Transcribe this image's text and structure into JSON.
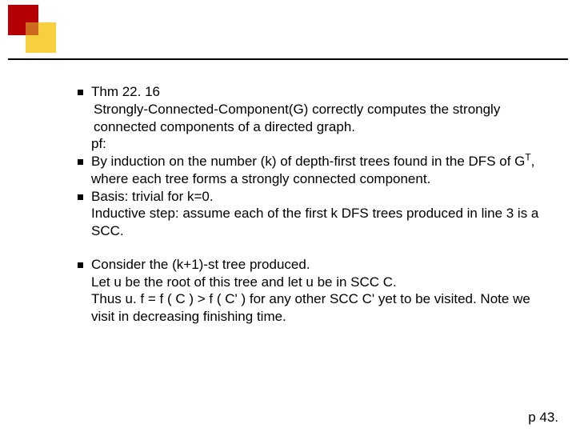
{
  "slide": {
    "b1": "Thm 22. 16",
    "b1_sub1": "Strongly-Connected-Component(G) correctly computes the strongly connected components of a directed graph.",
    "b1_sub2": "pf:",
    "b2_pre": "By induction on the number (k) of depth-first trees found in the DFS of G",
    "b2_sup": "T",
    "b2_post": ", where each tree forms a strongly connected component.",
    "b3": "Basis: trivial for k=0.",
    "b3_sub": "Inductive step: assume each of the first k DFS trees produced in line 3 is a SCC.",
    "b4": "Consider the (k+1)-st tree produced.",
    "b4_sub1": "Let u be the root of this tree and let u be in SCC C.",
    "b4_sub2": "Thus u. f = f ( C ) > f ( C' ) for any other SCC C'  yet to be visited.    Note we visit in decreasing finishing time.",
    "pagenum": "p 43."
  }
}
